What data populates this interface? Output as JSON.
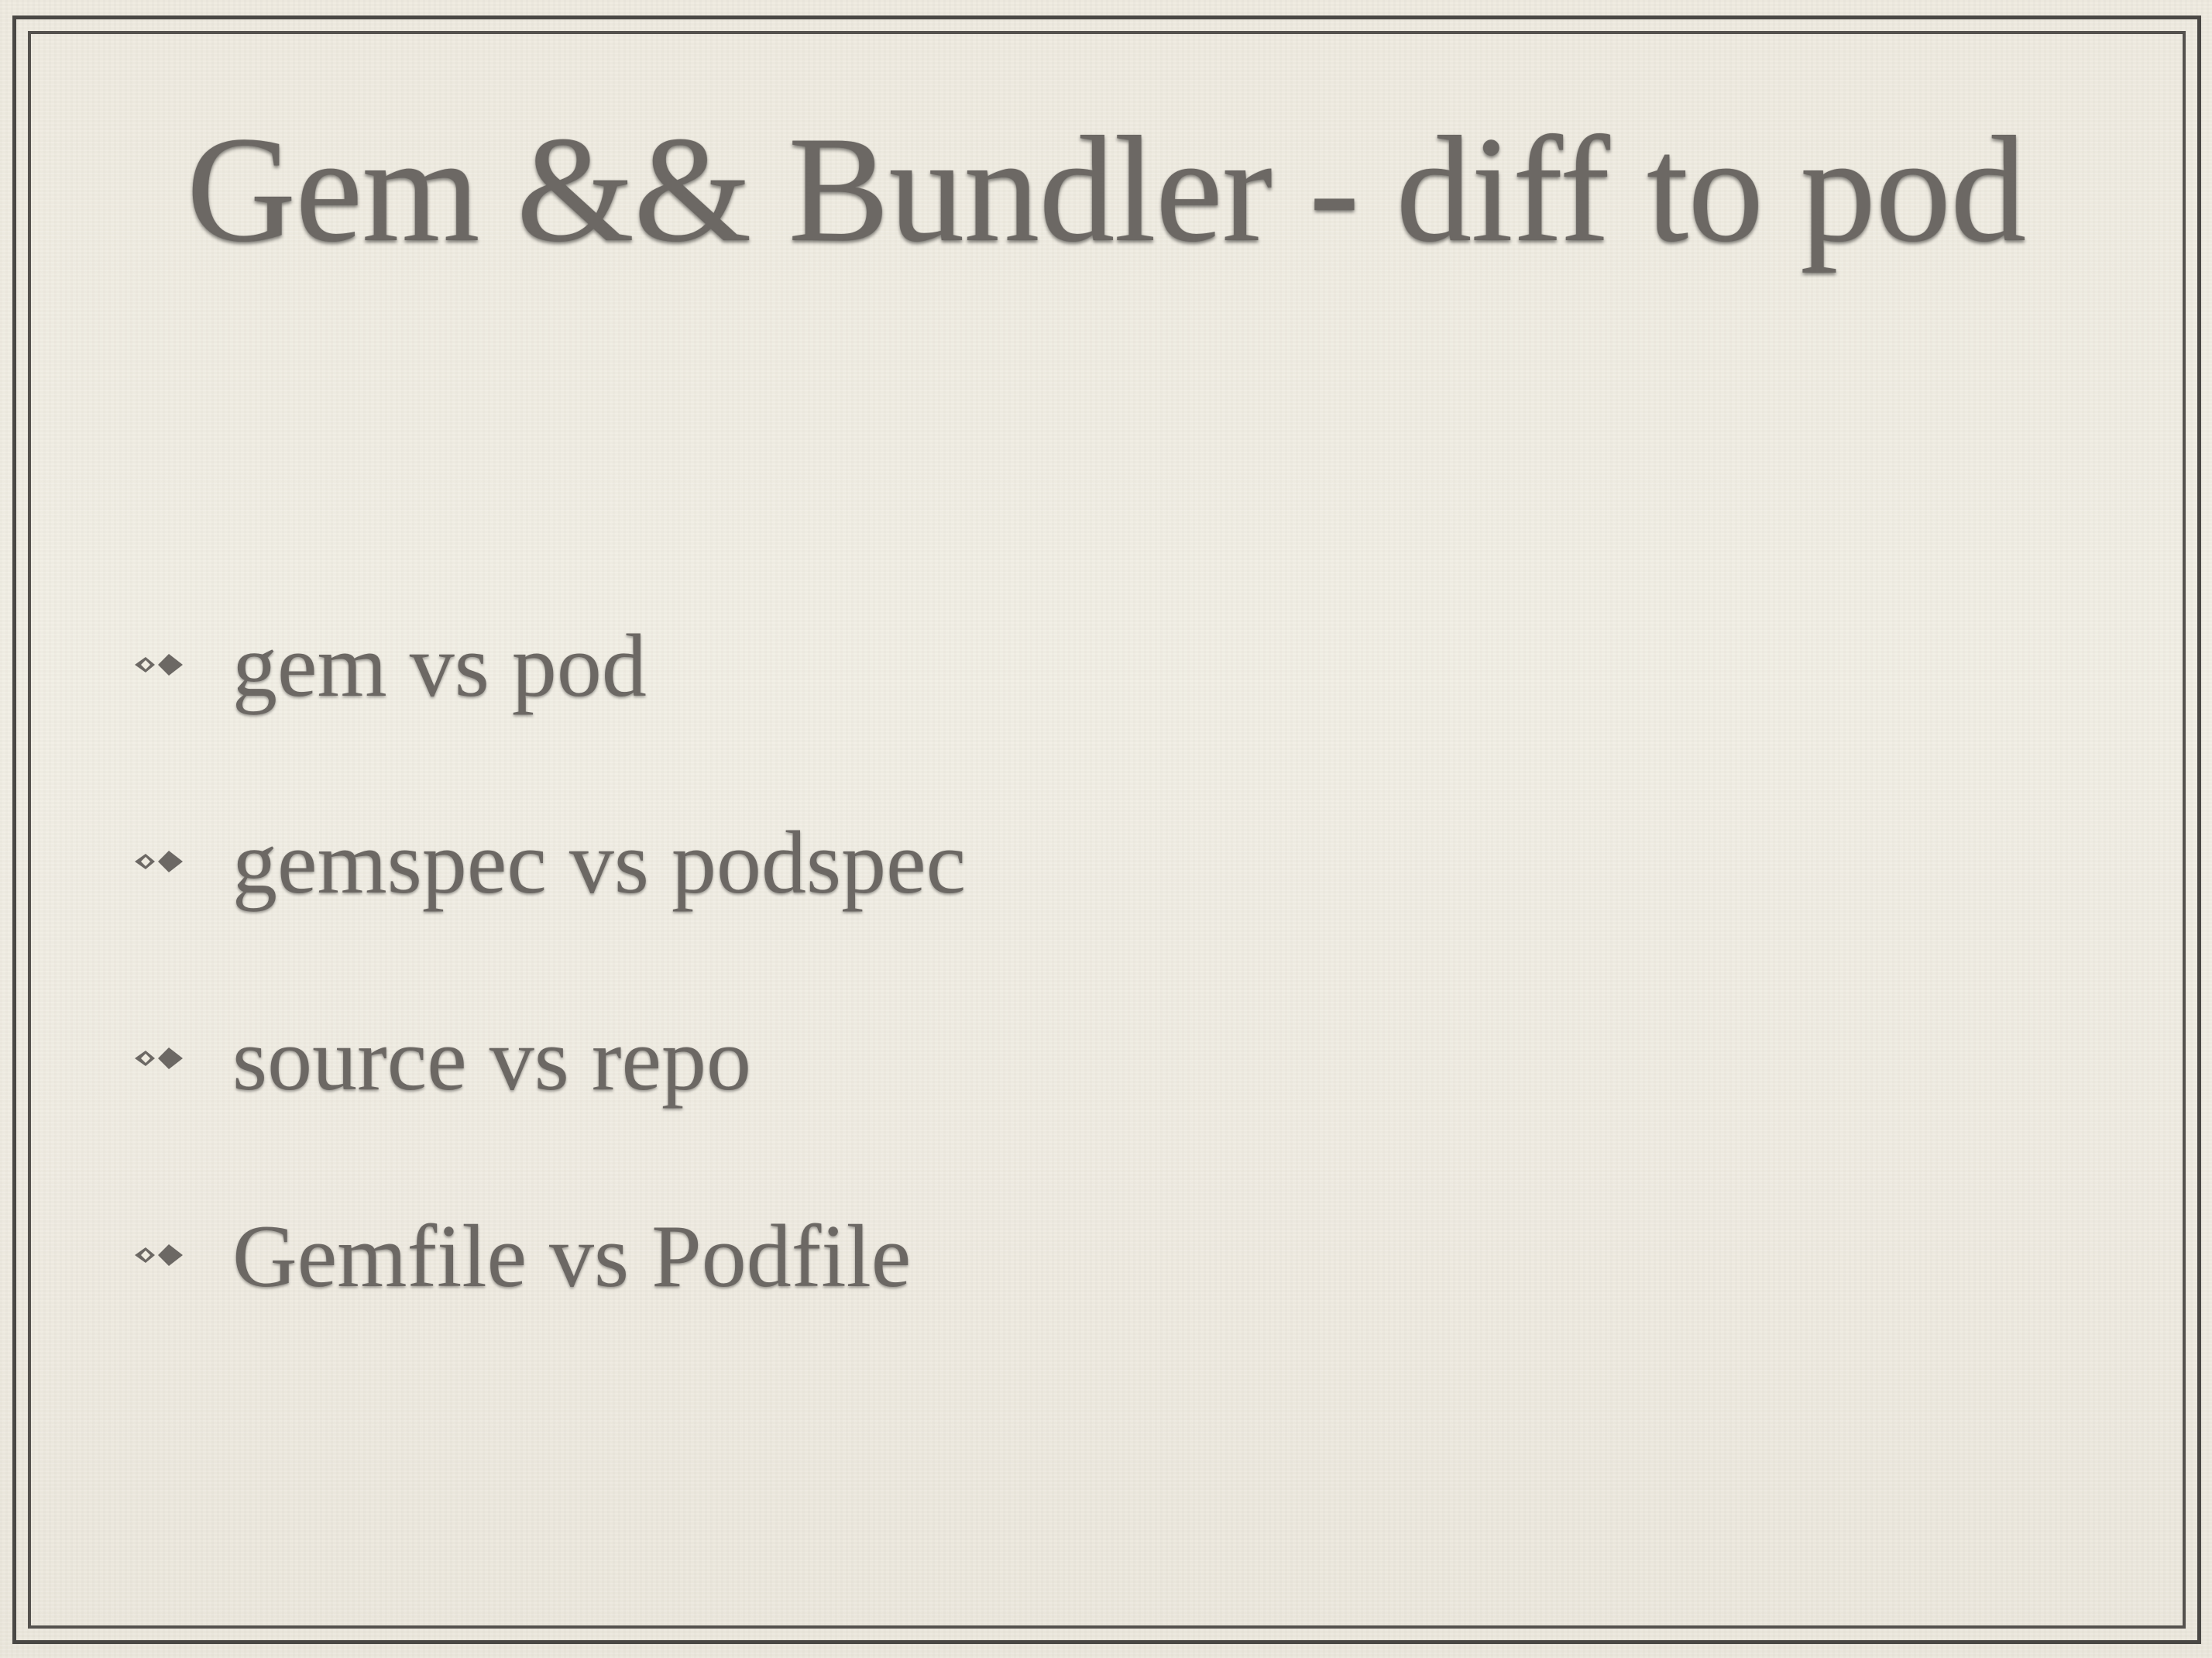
{
  "slide": {
    "title": "Gem && Bundler - diff to pod",
    "bullets": [
      {
        "label": "gem vs pod",
        "icon": "fleuron-bullet-icon"
      },
      {
        "label": "gemspec vs podspec",
        "icon": "fleuron-bullet-icon"
      },
      {
        "label": "source vs repo",
        "icon": "fleuron-bullet-icon"
      },
      {
        "label": "Gemfile vs Podfile",
        "icon": "fleuron-bullet-icon"
      }
    ]
  },
  "colors": {
    "background": "#efebe0",
    "text": "#6c6864",
    "frame": "#4a4845"
  }
}
